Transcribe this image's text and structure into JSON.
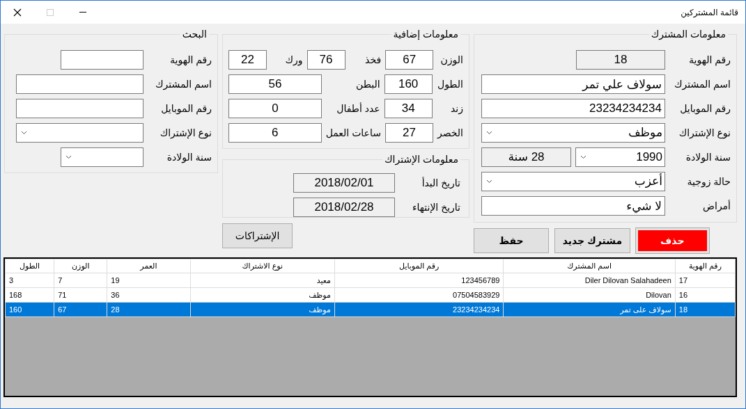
{
  "window": {
    "title": "قائمة المشتركين"
  },
  "subscriber_info": {
    "title": "معلومات المشترك",
    "fields": [
      {
        "label": "رقم الهوية",
        "kind": "text",
        "value": "18",
        "readonly": true
      },
      {
        "label": "اسم المشترك",
        "kind": "text",
        "value": "سولاف علي تمر",
        "readonly": false
      },
      {
        "label": "رقم الموبايل",
        "kind": "text",
        "value": "23234234234",
        "readonly": false
      },
      {
        "label": "نوع الإشتراك",
        "kind": "combo",
        "value": "موظف"
      },
      {
        "label": "سنة الولادة",
        "kind": "year",
        "value": "1990",
        "age": "28 سنة"
      },
      {
        "label": "حالة زوجية",
        "kind": "combo",
        "value": "أعزب"
      },
      {
        "label": "أمراض",
        "kind": "text",
        "value": "لا شيء",
        "readonly": false
      }
    ]
  },
  "buttons": [
    {
      "label": "حذف",
      "kind": "danger"
    },
    {
      "label": "مشترك جديد",
      "kind": "normal"
    },
    {
      "label": "حفظ",
      "kind": "normal"
    }
  ],
  "extra_info": {
    "title": "معلومات إضافية",
    "rows": [
      [
        {
          "label": "الوزن",
          "value": "67"
        },
        {
          "label": "فخذ",
          "value": "76"
        },
        {
          "label": "ورك",
          "value": "22"
        }
      ],
      [
        {
          "label": "الطول",
          "value": "160"
        },
        {
          "label": "البطن",
          "value": "56"
        }
      ],
      [
        {
          "label": "زند",
          "value": "34"
        },
        {
          "label": "عدد أطفال",
          "value": "0"
        }
      ],
      [
        {
          "label": "الخصر",
          "value": "27"
        },
        {
          "label": "ساعات العمل",
          "value": "6"
        }
      ]
    ]
  },
  "subscription_info": {
    "title": "معلومات الإشتراك",
    "fields": [
      {
        "label": "تاريخ البدأ",
        "value": "2018/02/01",
        "readonly": true
      },
      {
        "label": "تاريخ الإنتهاء",
        "value": "2018/02/28",
        "readonly": true
      }
    ]
  },
  "subscriptions_button": {
    "label": "الإشتراكات"
  },
  "search": {
    "title": "البحث",
    "fields": [
      {
        "label": "رقم الهوية",
        "kind": "text"
      },
      {
        "label": "اسم المشترك",
        "kind": "text"
      },
      {
        "label": "رقم الموبايل",
        "kind": "text"
      },
      {
        "label": "نوع الإشتراك",
        "kind": "combo"
      },
      {
        "label": "سنة الولادة",
        "kind": "combo"
      }
    ]
  },
  "table": {
    "columns": [
      "رقم الهوية",
      "اسم المشترك",
      "رقم الموبايل",
      "نوع الاشتراك",
      "العمر",
      "الوزن",
      "الطول"
    ],
    "rows": [
      {
        "cells": [
          "17",
          "Diler Dilovan Salahadeen",
          "123456789",
          "معيد",
          "19",
          "7",
          "3"
        ],
        "selected": false
      },
      {
        "cells": [
          "16",
          "Dilovan",
          "07504583929",
          "موظف",
          "36",
          "71",
          "168"
        ],
        "selected": false
      },
      {
        "cells": [
          "18",
          "سولاف على تمر",
          "23234234234",
          "موظف",
          "28",
          "67",
          "160"
        ],
        "selected": true
      }
    ]
  }
}
